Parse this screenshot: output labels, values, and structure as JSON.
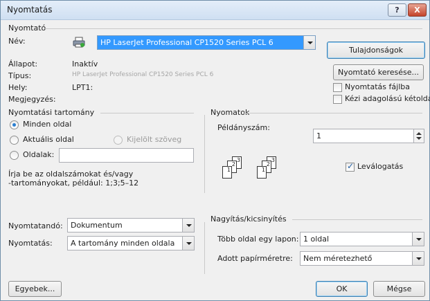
{
  "window": {
    "title": "Nyomtatás",
    "help_label": "?",
    "close_label": "X"
  },
  "printer": {
    "group_label": "Nyomtató",
    "name_label": "Név:",
    "name_value": "HP LaserJet Professional CP1520 Series PCL 6",
    "status_label": "Állapot:",
    "status_value": "Inaktív",
    "type_label": "Típus:",
    "type_value": "HP LaserJet Professional CP1520 Series PCL 6",
    "where_label": "Hely:",
    "where_value": "LPT1:",
    "comment_label": "Megjegyzés:",
    "properties_button": "Tulajdonságok",
    "find_printer_button": "Nyomtató keresése...",
    "print_to_file_label": "Nyomtatás fájlba",
    "manual_duplex_label": "Kézi adagolású kétoldalas"
  },
  "range": {
    "group_label": "Nyomtatási tartomány",
    "all_label": "Minden oldal",
    "current_label": "Aktuális oldal",
    "selection_label": "Kijelölt szöveg",
    "pages_label": "Oldalak:",
    "pages_value": "",
    "hint": "Írja be az oldalszámokat és/vagy\n-tartományokat, például: 1;3;5–12"
  },
  "copies": {
    "group_label": "Nyomatok",
    "count_label": "Példányszám:",
    "count_value": "1",
    "collate_label": "Leválogatás",
    "collate_checked": true
  },
  "print_what": {
    "label": "Nyomtatandó:",
    "value": "Dokumentum"
  },
  "print_mode": {
    "label": "Nyomtatás:",
    "value": "A tartomány minden oldala"
  },
  "zoom": {
    "group_label": "Nagyítás/kicsinyítés",
    "pages_per_sheet_label": "Több oldal egy lapon:",
    "pages_per_sheet_value": "1 oldal",
    "scale_to_paper_label": "Adott papírméretre:",
    "scale_to_paper_value": "Nem méretezhető"
  },
  "footer": {
    "options_button": "Egyebek...",
    "ok_button": "OK",
    "cancel_button": "Mégse"
  },
  "colors": {
    "accent": "#3c7fb1",
    "selected_printer_bg": "#3399ff"
  }
}
